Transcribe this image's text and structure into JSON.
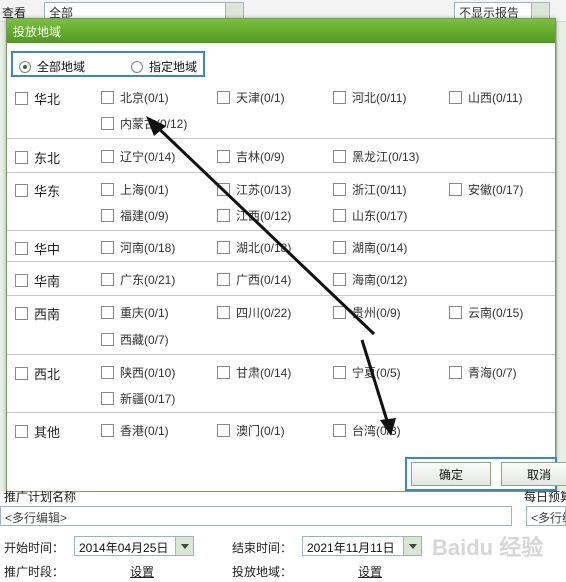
{
  "background": {
    "left_label": "查看",
    "left_select": "全部",
    "right_select": "不显示报告"
  },
  "dialog": {
    "title": "投放地域",
    "scope": {
      "all": "全部地域",
      "specific": "指定地域",
      "selected": "all"
    },
    "regions": [
      {
        "name": "华北",
        "items": [
          "北京(0/1)",
          "天津(0/1)",
          "河北(0/11)",
          "山西(0/11)",
          "内蒙古(0/12)"
        ]
      },
      {
        "name": "东北",
        "items": [
          "辽宁(0/14)",
          "吉林(0/9)",
          "黑龙江(0/13)"
        ]
      },
      {
        "name": "华东",
        "items": [
          "上海(0/1)",
          "江苏(0/13)",
          "浙江(0/11)",
          "安徽(0/17)",
          "福建(0/9)",
          "江西(0/12)",
          "山东(0/17)"
        ]
      },
      {
        "name": "华中",
        "items": [
          "河南(0/18)",
          "湖北(0/18)",
          "湖南(0/14)"
        ]
      },
      {
        "name": "华南",
        "items": [
          "广东(0/21)",
          "广西(0/14)",
          "海南(0/12)"
        ]
      },
      {
        "name": "西南",
        "items": [
          "重庆(0/1)",
          "四川(0/22)",
          "贵州(0/9)",
          "云南(0/15)",
          "西藏(0/7)"
        ]
      },
      {
        "name": "西北",
        "items": [
          "陕西(0/10)",
          "甘肃(0/14)",
          "宁夏(0/5)",
          "青海(0/7)",
          "新疆(0/17)"
        ]
      },
      {
        "name": "其他",
        "items": [
          "香港(0/1)",
          "澳门(0/1)",
          "台湾(0/3)"
        ]
      }
    ],
    "ok_label": "确定",
    "cancel_label": "取消"
  },
  "form": {
    "plan_name_label": "推广计划名称",
    "plan_name_placeholder": "<多行编辑>",
    "daily_budget_label": "每日预算",
    "daily_budget_placeholder": "<多行编",
    "start_label": "开始时间：",
    "start_value": "2014年04月25日",
    "end_label": "结束时间：",
    "end_value": "2021年11月11日",
    "period_label": "推广时段：",
    "period_link": "设置",
    "region_label": "投放地域：",
    "region_link": "设置"
  },
  "watermark": "Baidu 经验",
  "colors": {
    "title_green": "#5aa52a",
    "highlight_blue": "#3b87c6",
    "arrow": "#111111"
  }
}
